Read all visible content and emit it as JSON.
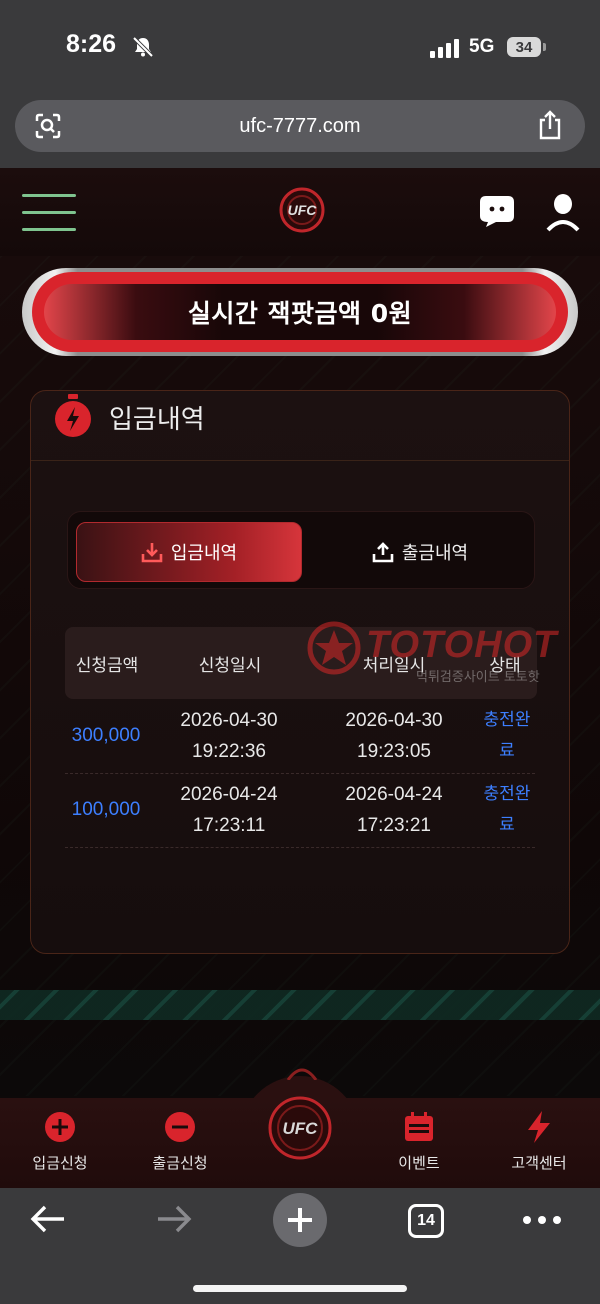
{
  "status_bar": {
    "time": "8:26",
    "network": "5G",
    "battery": "34"
  },
  "browser": {
    "url": "ufc-7777.com",
    "tabs_count": "14"
  },
  "jackpot": {
    "text": "실시간 잭팟금액  0원"
  },
  "panel": {
    "title": "입금내역",
    "tabs": [
      {
        "label": "입금내역",
        "active": true
      },
      {
        "label": "출금내역",
        "active": false
      }
    ],
    "columns": [
      "신청금액",
      "신청일시",
      "처리일시",
      "상태"
    ],
    "rows": [
      {
        "amount": "300,000",
        "requested_date": "2026-04-30",
        "requested_time": "19:22:36",
        "processed_date": "2026-04-30",
        "processed_time": "19:23:05",
        "status_line1": "충전완",
        "status_line2": "료"
      },
      {
        "amount": "100,000",
        "requested_date": "2026-04-24",
        "requested_time": "17:23:11",
        "processed_date": "2026-04-24",
        "processed_time": "17:23:21",
        "status_line1": "충전완",
        "status_line2": "료"
      }
    ]
  },
  "watermark": {
    "brand": "TOTOHOT",
    "subtitle": "먹튀검증사이트 토토핫"
  },
  "bottom_nav": {
    "items": [
      {
        "label": "입금신청"
      },
      {
        "label": "출금신청"
      },
      {
        "label": "이벤트"
      },
      {
        "label": "고객센터"
      }
    ]
  },
  "colors": {
    "accent_red": "#d9242c",
    "link_blue": "#3d7fff",
    "menu_green": "#7fc48f"
  }
}
